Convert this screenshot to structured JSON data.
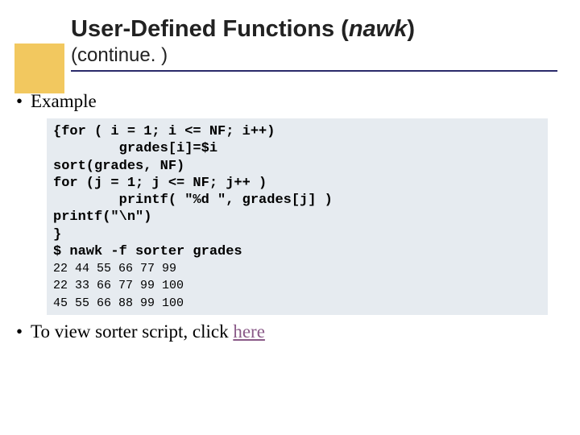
{
  "title": {
    "main": "User-Defined Functions (",
    "emph": "nawk",
    "tail": ")",
    "subtitle": "(continue. )"
  },
  "bullets": {
    "example_label": "Example",
    "view_prefix": "To view sorter script, click ",
    "view_link": "here"
  },
  "code": {
    "l1": "{for ( i = 1; i <= NF; i++)",
    "l2": "        grades[i]=$i",
    "l3": "sort(grades, NF)",
    "l4": "for (j = 1; j <= NF; j++ )",
    "l5": "        printf( \"%d \", grades[j] )",
    "l6": "printf(\"\\n\")",
    "l7": "}",
    "l8": "$ nawk -f sorter grades",
    "o1": "22 44 55 66 77 99",
    "o2": "22 33 66 77 99 100",
    "o3": "45 55 66 88 99 100"
  }
}
